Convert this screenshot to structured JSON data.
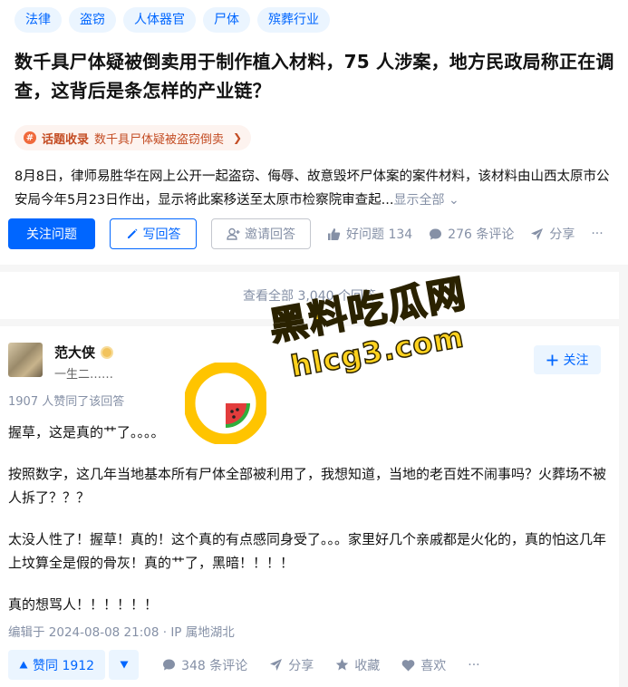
{
  "topics": [
    "法律",
    "盗窃",
    "人体器官",
    "尸体",
    "殡葬行业"
  ],
  "question": {
    "title": "数千具尸体疑被倒卖用于制作植入材料，75 人涉案，地方民政局称正在调查，这背后是条怎样的产业链？",
    "collection_tag": "话题收录",
    "collection_name": "数千具尸体疑被盗窃倒卖",
    "excerpt": "8月8日，律师易胜华在网上公开一起盗窃、侮辱、故意毁坏尸体案的案件材料，该材料由山西太原市公安局今年5月23日作出，显示将此案移送至太原市检察院审查起...",
    "show_all": "显示全部"
  },
  "question_actions": {
    "follow": "关注问题",
    "write": "写回答",
    "invite": "邀请回答",
    "good_question": "好问题 134",
    "comments": "276 条评论",
    "share": "分享",
    "more": "···"
  },
  "view_all_answers": "查看全部 3,040 个回答",
  "answer": {
    "author_name": "范大侠",
    "author_bio": "一生二……",
    "follow": "关注",
    "agree_text": "1907 人赞同了该回答",
    "paragraphs": [
      "握草，这是真的艹了。。。。",
      "按照数字，这几年当地基本所有尸体全部被利用了，我想知道，当地的老百姓不闹事吗？火葬场不被人拆了？？？",
      "太没人性了！握草！真的！这个真的有点感同身受了。。。家里好几个亲戚都是火化的，真的怕这几年上坟算全是假的骨灰！真的艹了，黑暗！！！！",
      "真的想骂人！！！！！！"
    ],
    "edited": "编辑于 2024-08-08 21:08 · IP 属地湖北"
  },
  "answer_actions": {
    "vote_up": "赞同 1912",
    "comments": "348 条评论",
    "share": "分享",
    "favorite": "收藏",
    "like": "喜欢",
    "more": "···"
  },
  "watermark": {
    "line1": "黑料吃瓜网",
    "line2": "hlcg3.com"
  },
  "colors": {
    "accent": "#0066ff",
    "topic_bg": "#ebf5ff",
    "meta_gray": "#8590a6",
    "collect_orange": "#c44d24",
    "watermark_yellow": "#ffd21e"
  }
}
